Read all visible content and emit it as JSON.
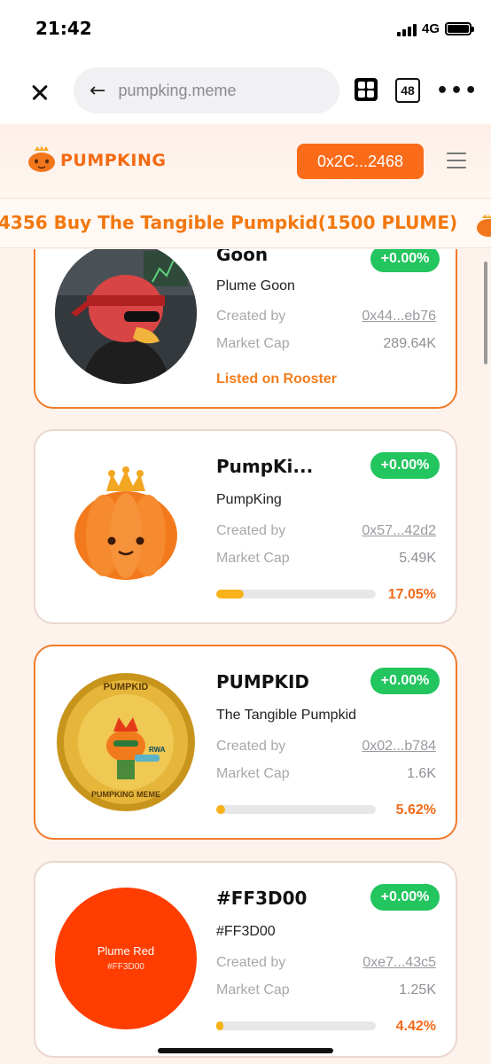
{
  "status": {
    "time": "21:42",
    "network": "4G"
  },
  "browser": {
    "url": "pumpking.meme",
    "tab_count": "48"
  },
  "header": {
    "logo_text": "PUMPKING",
    "wallet_label": "0x2C...2468"
  },
  "ticker": {
    "text": "4356 Buy The Tangible Pumpkid(1500 PLUME)"
  },
  "cards": [
    {
      "title": "Goon",
      "change": "+0.00%",
      "name": "Plume Goon",
      "created_label": "Created by",
      "created_value": "0x44...eb76",
      "mcap_label": "Market Cap",
      "mcap_value": "289.64K",
      "listed": "Listed on Rooster"
    },
    {
      "title": "PumpKi...",
      "change": "+0.00%",
      "name": "PumpKing",
      "created_label": "Created by",
      "created_value": "0x57...42d2",
      "mcap_label": "Market Cap",
      "mcap_value": "5.49K",
      "progress": 17.05,
      "progress_text": "17.05%"
    },
    {
      "title": "PUMPKID",
      "change": "+0.00%",
      "name": "The Tangible Pumpkid",
      "created_label": "Created by",
      "created_value": "0x02...b784",
      "mcap_label": "Market Cap",
      "mcap_value": "1.6K",
      "progress": 5.62,
      "progress_text": "5.62%",
      "coin_top": "PUMPKID",
      "coin_bottom": "PUMPKING MEME",
      "coin_tag": "RWA"
    },
    {
      "title": "#FF3D00",
      "change": "+0.00%",
      "name": "#FF3D00",
      "created_label": "Created by",
      "created_value": "0xe7...43c5",
      "mcap_label": "Market Cap",
      "mcap_value": "1.25K",
      "progress": 4.42,
      "progress_text": "4.42%",
      "image_title": "Plume Red",
      "image_sub": "#FF3D00"
    }
  ],
  "colors": {
    "accent": "#fa6b1a",
    "badge": "#22c55e",
    "progress": "#f8b21a",
    "swatch": "#ff3d00"
  }
}
